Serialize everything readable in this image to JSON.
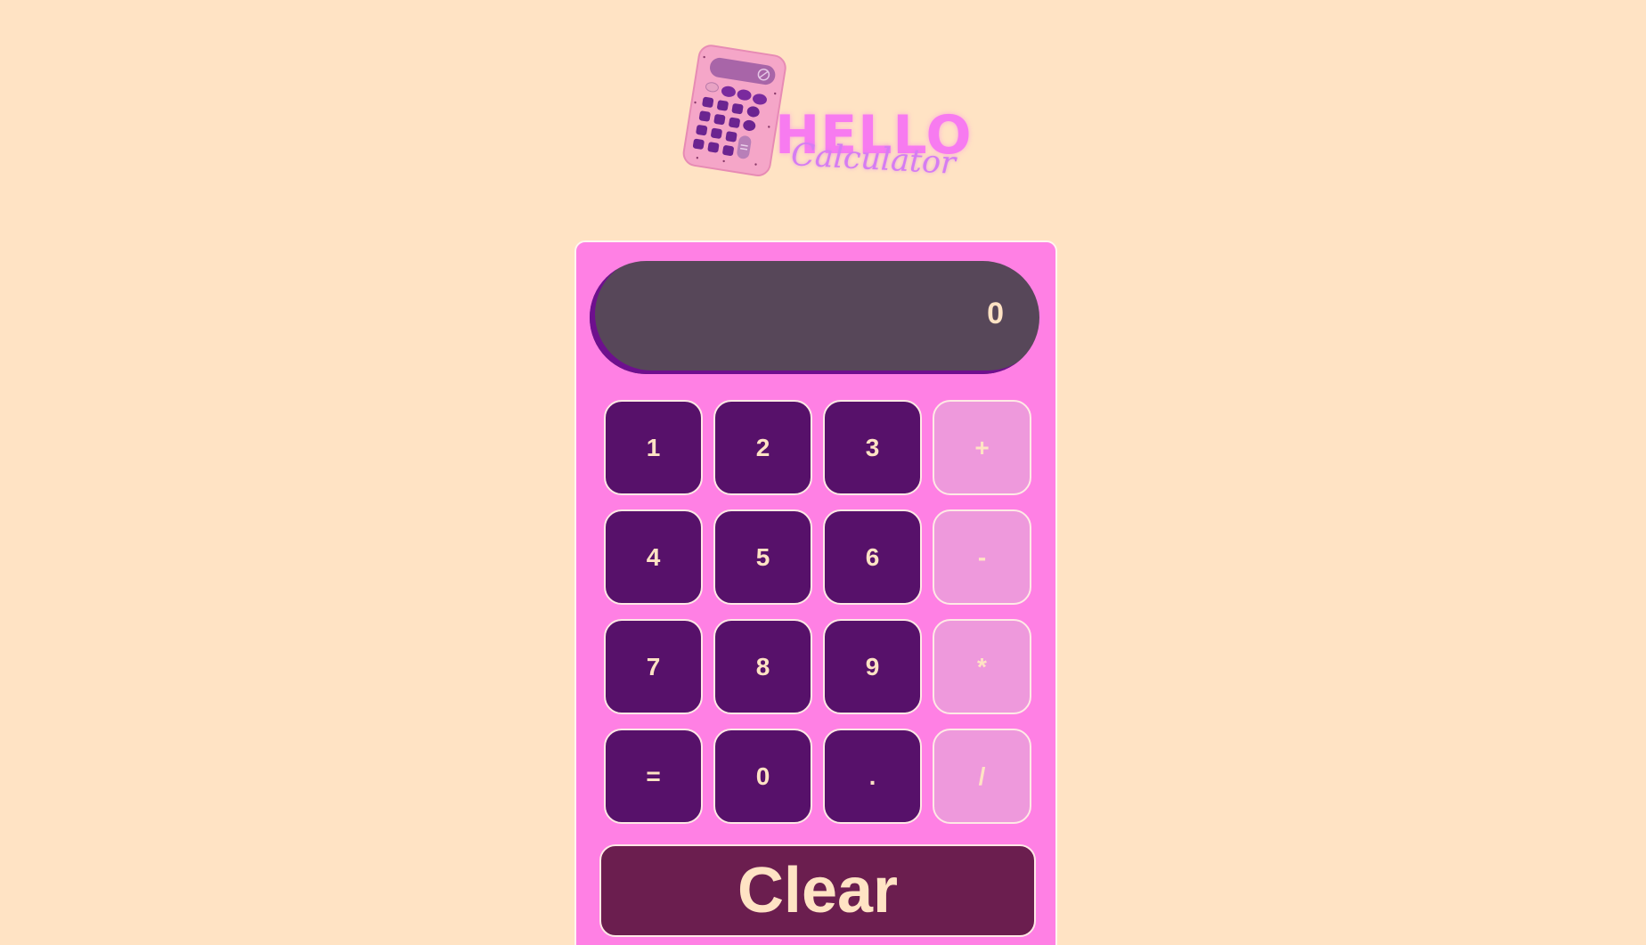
{
  "logo": {
    "title": "HELLO",
    "subtitle": "Calculator",
    "icon": "calculator-icon"
  },
  "display": {
    "value": "0"
  },
  "keypad": {
    "rows": [
      [
        "1",
        "2",
        "3",
        "+"
      ],
      [
        "4",
        "5",
        "6",
        "-"
      ],
      [
        "7",
        "8",
        "9",
        "*"
      ],
      [
        "=",
        "0",
        ".",
        "/"
      ]
    ]
  },
  "clear_label": "Clear",
  "colors": {
    "background": "#FFE3C4",
    "calculator_body": "#FF80E4",
    "display": "#574759",
    "number_key": "#57116A",
    "operator_key": "#EE99DC",
    "clear_button": "#6B1E4F",
    "text": "#FFE3C4"
  }
}
